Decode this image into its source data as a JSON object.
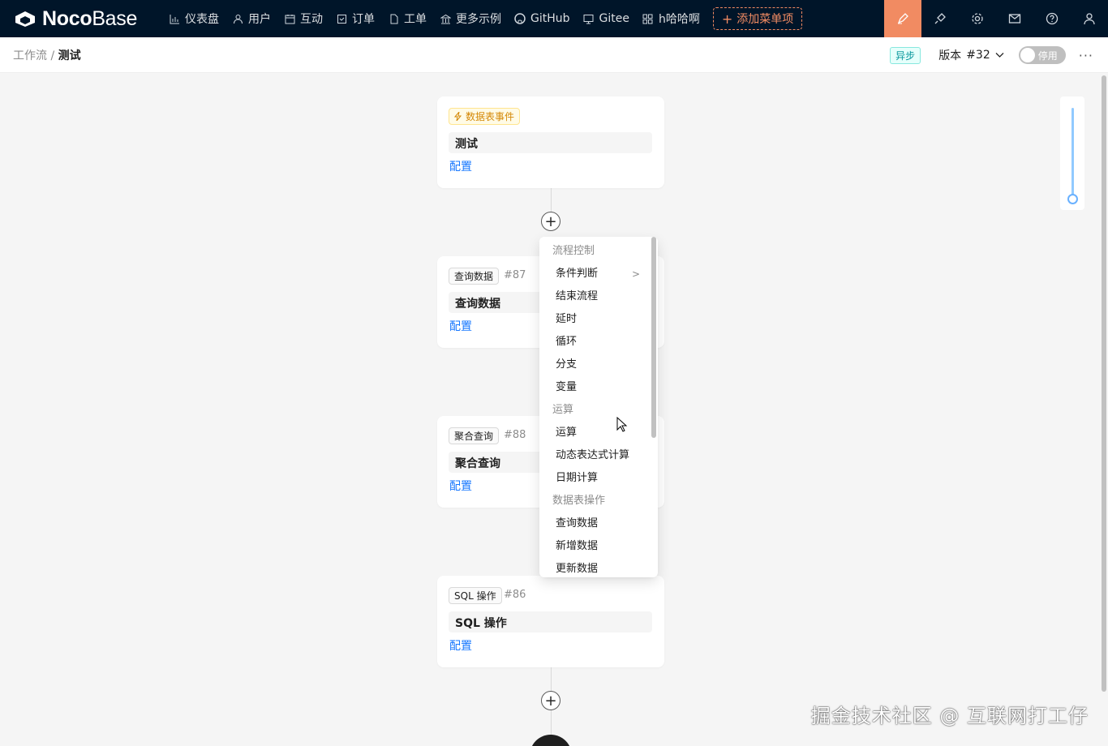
{
  "brand": {
    "bold": "Noco",
    "light": "Base"
  },
  "nav": [
    {
      "label": "仪表盘",
      "icon": "bar-chart-icon"
    },
    {
      "label": "用户",
      "icon": "user-icon"
    },
    {
      "label": "互动",
      "icon": "calendar-icon"
    },
    {
      "label": "订单",
      "icon": "order-icon"
    },
    {
      "label": "工单",
      "icon": "file-icon"
    },
    {
      "label": "更多示例",
      "icon": "bank-icon"
    },
    {
      "label": "GitHub",
      "icon": "github-icon"
    },
    {
      "label": "Gitee",
      "icon": "desktop-icon"
    },
    {
      "label": "h哈哈啊",
      "icon": "app-icon"
    }
  ],
  "add_menu_label": "添加菜单项",
  "breadcrumb": {
    "parent": "工作流",
    "separator": " / ",
    "current": "测试"
  },
  "header": {
    "async_tag": "异步",
    "version_label": "版本",
    "version_value": "#32",
    "toggle_label": "停用",
    "more": "···"
  },
  "nodes": [
    {
      "badge": "数据表事件",
      "num": "",
      "title": "测试",
      "config": "配置",
      "trigger": true
    },
    {
      "badge": "查询数据",
      "num": "#87",
      "title": "查询数据",
      "config": "配置"
    },
    {
      "badge": "聚合查询",
      "num": "#88",
      "title": "聚合查询",
      "config": "配置"
    },
    {
      "badge": "SQL 操作",
      "num": "#86",
      "title": "SQL 操作",
      "config": "配置"
    }
  ],
  "menu": {
    "groups": [
      {
        "label": "流程控制",
        "items": [
          "条件判断",
          "结束流程",
          "延时",
          "循环",
          "分支",
          "变量"
        ]
      },
      {
        "label": "运算",
        "items": [
          "运算",
          "动态表达式计算",
          "日期计算"
        ]
      },
      {
        "label": "数据表操作",
        "items": [
          "查询数据",
          "新增数据",
          "更新数据"
        ]
      }
    ],
    "submenu_item": "条件判断"
  },
  "watermark": "掘金技术社区 @ 互联网打工仔",
  "colors": {
    "topbar": "#001529",
    "accent": "#f18b62",
    "link": "#1677ff"
  }
}
